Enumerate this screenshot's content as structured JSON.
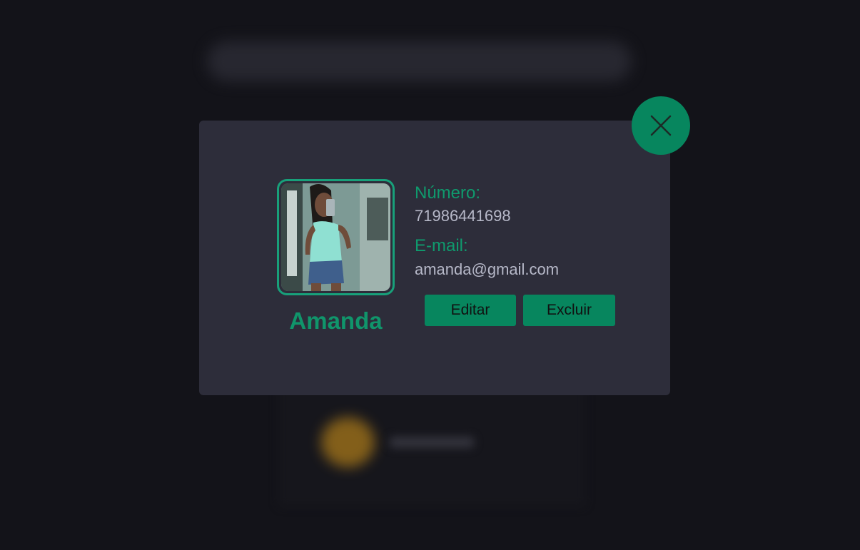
{
  "contact": {
    "name": "Amanda",
    "number_label": "Número:",
    "number": "71986441698",
    "email_label": "E-mail:",
    "email": "amanda@gmail.com"
  },
  "actions": {
    "edit_label": "Editar",
    "delete_label": "Excluir"
  },
  "icons": {
    "close": "close-icon",
    "photo": "contact-photo"
  },
  "colors": {
    "accent": "#07865e",
    "accent_text": "#10956b",
    "modal_bg": "#2d2d3a",
    "page_bg": "#131319",
    "value_text": "#b6b8c8"
  }
}
